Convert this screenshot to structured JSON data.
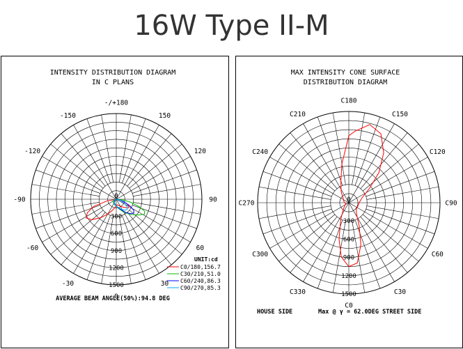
{
  "title": "16W Type II-M",
  "chart_data": [
    {
      "type": "polar",
      "title_line1": "INTENSITY DISTRIBUTION DIAGRAM",
      "title_line2": "IN C PLANS",
      "angle_labels": [
        {
          "text": "-/+180",
          "angle": 180
        },
        {
          "text": "150",
          "angle": 150
        },
        {
          "text": "120",
          "angle": 120
        },
        {
          "text": "90",
          "angle": 90
        },
        {
          "text": "60",
          "angle": 60
        },
        {
          "text": "30",
          "angle": 30
        },
        {
          "text": "0",
          "angle": 0
        },
        {
          "text": "-30",
          "angle": -30
        },
        {
          "text": "-60",
          "angle": -60
        },
        {
          "text": "-90",
          "angle": -90
        },
        {
          "text": "-120",
          "angle": -120
        },
        {
          "text": "-150",
          "angle": -150
        }
      ],
      "radial_ticks": [
        "0",
        "300",
        "600",
        "900",
        "1200",
        "1500"
      ],
      "radial_max": 1500,
      "unit_label": "UNIT:cd",
      "series": [
        {
          "name": "C0/180,156.7",
          "color": "#ff0000",
          "points": [
            [
              -90,
              0
            ],
            [
              -80,
              160
            ],
            [
              -72,
              420
            ],
            [
              -65,
              560
            ],
            [
              -58,
              620
            ],
            [
              -50,
              560
            ],
            [
              -40,
              420
            ],
            [
              -30,
              300
            ],
            [
              -20,
              210
            ],
            [
              -10,
              150
            ],
            [
              0,
              120
            ],
            [
              10,
              100
            ],
            [
              20,
              110
            ],
            [
              30,
              140
            ],
            [
              40,
              180
            ],
            [
              50,
              230
            ],
            [
              55,
              260
            ],
            [
              60,
              255
            ],
            [
              65,
              220
            ],
            [
              72,
              140
            ],
            [
              80,
              60
            ],
            [
              90,
              0
            ]
          ]
        },
        {
          "name": "C30/210,51.0",
          "color": "#00bb00",
          "points": [
            [
              -90,
              0
            ],
            [
              -75,
              40
            ],
            [
              -60,
              60
            ],
            [
              -40,
              80
            ],
            [
              -20,
              100
            ],
            [
              0,
              120
            ],
            [
              15,
              170
            ],
            [
              30,
              260
            ],
            [
              45,
              380
            ],
            [
              55,
              480
            ],
            [
              62,
              560
            ],
            [
              67,
              540
            ],
            [
              72,
              420
            ],
            [
              78,
              260
            ],
            [
              84,
              110
            ],
            [
              90,
              0
            ]
          ]
        },
        {
          "name": "C60/240,86.3",
          "color": "#0000ff",
          "points": [
            [
              -90,
              0
            ],
            [
              -60,
              40
            ],
            [
              -30,
              70
            ],
            [
              0,
              120
            ],
            [
              20,
              180
            ],
            [
              35,
              280
            ],
            [
              45,
              360
            ],
            [
              52,
              390
            ],
            [
              58,
              360
            ],
            [
              64,
              260
            ],
            [
              72,
              140
            ],
            [
              80,
              50
            ],
            [
              90,
              0
            ]
          ]
        },
        {
          "name": "C90/270,85.3",
          "color": "#00aaff",
          "points": [
            [
              -90,
              0
            ],
            [
              -70,
              20
            ],
            [
              -40,
              60
            ],
            [
              -20,
              90
            ],
            [
              0,
              120
            ],
            [
              15,
              150
            ],
            [
              30,
              210
            ],
            [
              40,
              250
            ],
            [
              48,
              260
            ],
            [
              55,
              230
            ],
            [
              65,
              150
            ],
            [
              75,
              70
            ],
            [
              90,
              0
            ]
          ]
        }
      ],
      "beam_angle_text": "AVERAGE BEAM ANGLE(50%):94.8 DEG"
    },
    {
      "type": "polar",
      "title_line1": "MAX INTENSITY CONE SURFACE",
      "title_line2": "DISTRIBUTION DIAGRAM",
      "angle_labels": [
        {
          "text": "C180",
          "angle": 180
        },
        {
          "text": "C150",
          "angle": 150
        },
        {
          "text": "C120",
          "angle": 120
        },
        {
          "text": "C90",
          "angle": 90
        },
        {
          "text": "C60",
          "angle": 60
        },
        {
          "text": "C30",
          "angle": 30
        },
        {
          "text": "C0",
          "angle": 0
        },
        {
          "text": "C330",
          "angle": -30
        },
        {
          "text": "C300",
          "angle": -60
        },
        {
          "text": "C270",
          "angle": -90
        },
        {
          "text": "C240",
          "angle": -120
        },
        {
          "text": "C210",
          "angle": -150
        }
      ],
      "radial_ticks": [
        "0",
        "300",
        "600",
        "900",
        "1200",
        "1500"
      ],
      "radial_max": 1500,
      "series": [
        {
          "name": "",
          "color": "#ff0000",
          "points": [
            [
              0,
              1050
            ],
            [
              8,
              1000
            ],
            [
              16,
              720
            ],
            [
              24,
              420
            ],
            [
              35,
              220
            ],
            [
              50,
              160
            ],
            [
              70,
              160
            ],
            [
              90,
              170
            ],
            [
              110,
              230
            ],
            [
              125,
              420
            ],
            [
              135,
              700
            ],
            [
              145,
              1000
            ],
            [
              155,
              1250
            ],
            [
              165,
              1330
            ],
            [
              175,
              1180
            ],
            [
              180,
              1100
            ],
            [
              190,
              650
            ],
            [
              200,
              380
            ],
            [
              215,
              220
            ],
            [
              235,
              110
            ],
            [
              260,
              80
            ],
            [
              270,
              70
            ],
            [
              285,
              50
            ],
            [
              300,
              70
            ],
            [
              320,
              140
            ],
            [
              335,
              320
            ],
            [
              345,
              620
            ],
            [
              352,
              900
            ],
            [
              360,
              1050
            ]
          ]
        }
      ],
      "house_side": "HOUSE SIDE",
      "max_text": "Max @ γ = 62.0DEG STREET SIDE"
    }
  ]
}
